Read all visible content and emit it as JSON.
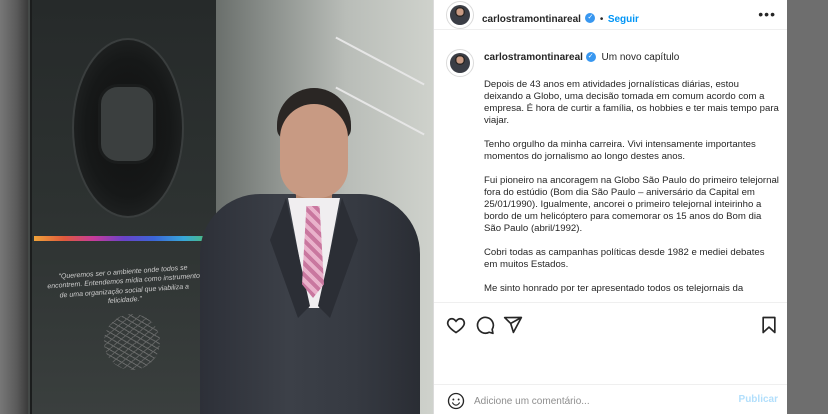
{
  "post": {
    "username": "carlostramontinareal",
    "follow_label": "Seguir",
    "separator": "•",
    "more_label": "•••",
    "caption_title": "Um novo capítulo",
    "paragraphs": [
      "Depois de 43 anos em atividades jornalísticas diárias, estou deixando a Globo, uma decisão tomada em comum acordo com a empresa. É hora de curtir a família, os hobbies e ter mais tempo para viajar.",
      "Tenho orgulho da minha carreira. Vivi intensamente importantes momentos do jornalismo ao longo destes anos.",
      "Fui pioneiro na ancoragem na Globo São Paulo do primeiro telejornal fora do estúdio (Bom dia São Paulo – aniversário da Capital em 25/01/1990). Igualmente, ancorei o primeiro telejornal inteirinho a bordo de um helicóptero para comemorar os 15 anos do Bom dia São Paulo (abril/1992).",
      "Cobri todas as campanhas políticas desde 1982 e mediei debates em muitos Estados.",
      "Me sinto honrado por ter apresentado todos os telejornais da"
    ]
  },
  "comment": {
    "placeholder": "Adicione um comentário...",
    "publish_label": "Publicar"
  },
  "photo": {
    "plaque_quote": "\"Queremos ser o ambiente onde todos se encontrem. Entendemos mídia como instrumento de uma organização social que viabiliza a felicidade.\""
  },
  "colors": {
    "accent": "#0095f6",
    "verified": "#3897f0",
    "text": "#262626",
    "publish_disabled": "#b2dffc"
  },
  "icons": [
    "heart-icon",
    "comment-icon",
    "share-icon",
    "bookmark-icon",
    "emoji-icon",
    "verified-icon",
    "more-icon"
  ]
}
